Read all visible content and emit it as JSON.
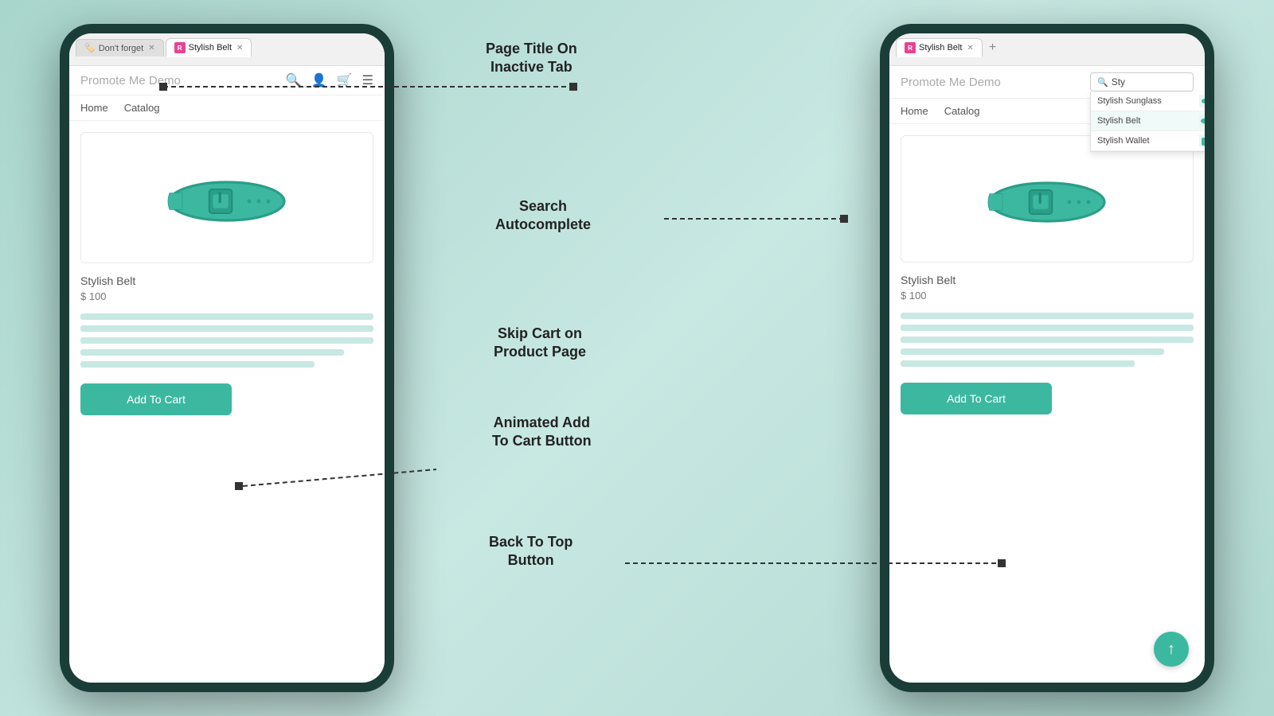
{
  "annotations": {
    "page_title_label": "Page Title On\nInactive Tab",
    "search_autocomplete_label": "Search\nAutocomplete",
    "skip_cart_label": "Skip Cart on\nProduct Page",
    "animated_add_label": "Animated Add\nTo Cart Button",
    "back_to_top_label": "Back To Top\nButton"
  },
  "left_phone": {
    "tabs": [
      {
        "label": "Don't forget",
        "icon": "emoji",
        "active": false,
        "has_close": true
      },
      {
        "label": "Stylish Belt",
        "icon": "r-logo",
        "active": true,
        "has_close": true
      }
    ],
    "site_title": "Promote Me Demo",
    "nav_items": [
      "Home",
      "Catalog"
    ],
    "product": {
      "title": "Stylish Belt",
      "price": "$ 100",
      "image_alt": "Stylish Belt image"
    },
    "add_to_cart": "Add To Cart"
  },
  "right_phone": {
    "tabs": [
      {
        "label": "Stylish Belt",
        "icon": "r-logo",
        "active": true,
        "has_close": true
      }
    ],
    "site_title": "Promote Me Demo",
    "nav_items": [
      "Home",
      "Catalog"
    ],
    "search_placeholder": "Sty",
    "autocomplete_items": [
      {
        "label": "Stylish Sunglass",
        "has_thumb": true
      },
      {
        "label": "Stylish Belt",
        "has_thumb": true
      },
      {
        "label": "Stylish Wallet",
        "has_thumb": true
      }
    ],
    "product": {
      "title": "Stylish Belt",
      "price": "$ 100",
      "image_alt": "Stylish Belt image"
    },
    "add_to_cart": "Add To Cart",
    "back_to_top_label": "↑"
  }
}
